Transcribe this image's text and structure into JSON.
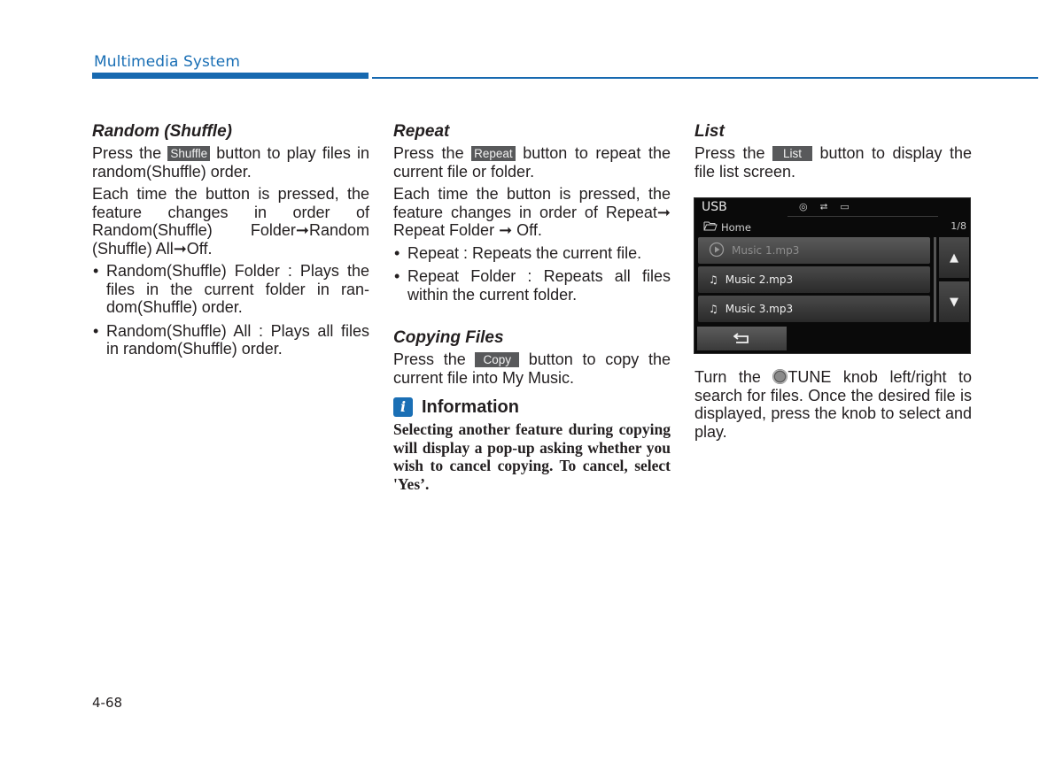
{
  "header": {
    "title": "Multimedia System",
    "accent_color": "#1769b0"
  },
  "columns": {
    "random": {
      "heading": "Random (Shuffle)",
      "p1_before": "Press the ",
      "button_label": "Shuffle",
      "p1_after": " button to play files in random(Shuffle) order.",
      "p2": "Each time the button is pressed, the feature changes in order of Random(Shuffle) Folder➞Random (Shuffle) All➞Off.",
      "bullets": [
        "Random(Shuffle) Folder : Plays the files in the current folder in ran-dom(Shuffle) order.",
        "Random(Shuffle) All : Plays all files in random(Shuffle) order."
      ]
    },
    "repeat": {
      "heading": "Repeat",
      "p1_before": "Press the ",
      "button_label": "Repeat",
      "p1_after": " button to repeat the current file or folder.",
      "p2": "Each time the button is pressed, the feature changes in order of Repeat➞ Repeat Folder ➞ Off.",
      "bullets": [
        "Repeat : Repeats the current file.",
        "Repeat Folder : Repeats all files within the current folder."
      ]
    },
    "copying": {
      "heading": "Copying Files",
      "p1_before": "Press the ",
      "button_label": "Copy",
      "p1_after": " button to copy the current file into My Music."
    },
    "information": {
      "icon": "info-icon",
      "icon_glyph": "i",
      "title": "Information",
      "body": "Selecting another feature during copying will display a pop-up asking whether you wish to cancel copying. To cancel, select 'Yes’."
    },
    "list": {
      "heading": "List",
      "p1_before": "Press the ",
      "button_label": "List",
      "p1_after": " button to display the file list screen.",
      "p2_before": "Turn the ",
      "knob_icon": "tune-knob-icon",
      "p2_after": "TUNE knob left/right to search for files. Once the desired file is displayed, press the knob to select and play."
    }
  },
  "screen": {
    "source": "USB",
    "status_icons": [
      "disc-icon",
      "usb-icon",
      "battery-icon"
    ],
    "status_glyphs": [
      "◎",
      "⮂",
      "▭"
    ],
    "folder_icon": "🗁",
    "folder": "Home",
    "page_indicator": "1/8",
    "files": [
      {
        "name": "Music 1.mp3",
        "icon": "play-icon",
        "glyph": "▶",
        "state": "playing"
      },
      {
        "name": "Music 2.mp3",
        "icon": "music-note-icon",
        "glyph": "♫",
        "state": "normal"
      },
      {
        "name": "Music 3.mp3",
        "icon": "music-note-icon",
        "glyph": "♫",
        "state": "normal"
      }
    ],
    "up_glyph": "▲",
    "down_glyph": "▼",
    "back_glyph": "⮌"
  },
  "footer": {
    "page_number": "4-68"
  }
}
